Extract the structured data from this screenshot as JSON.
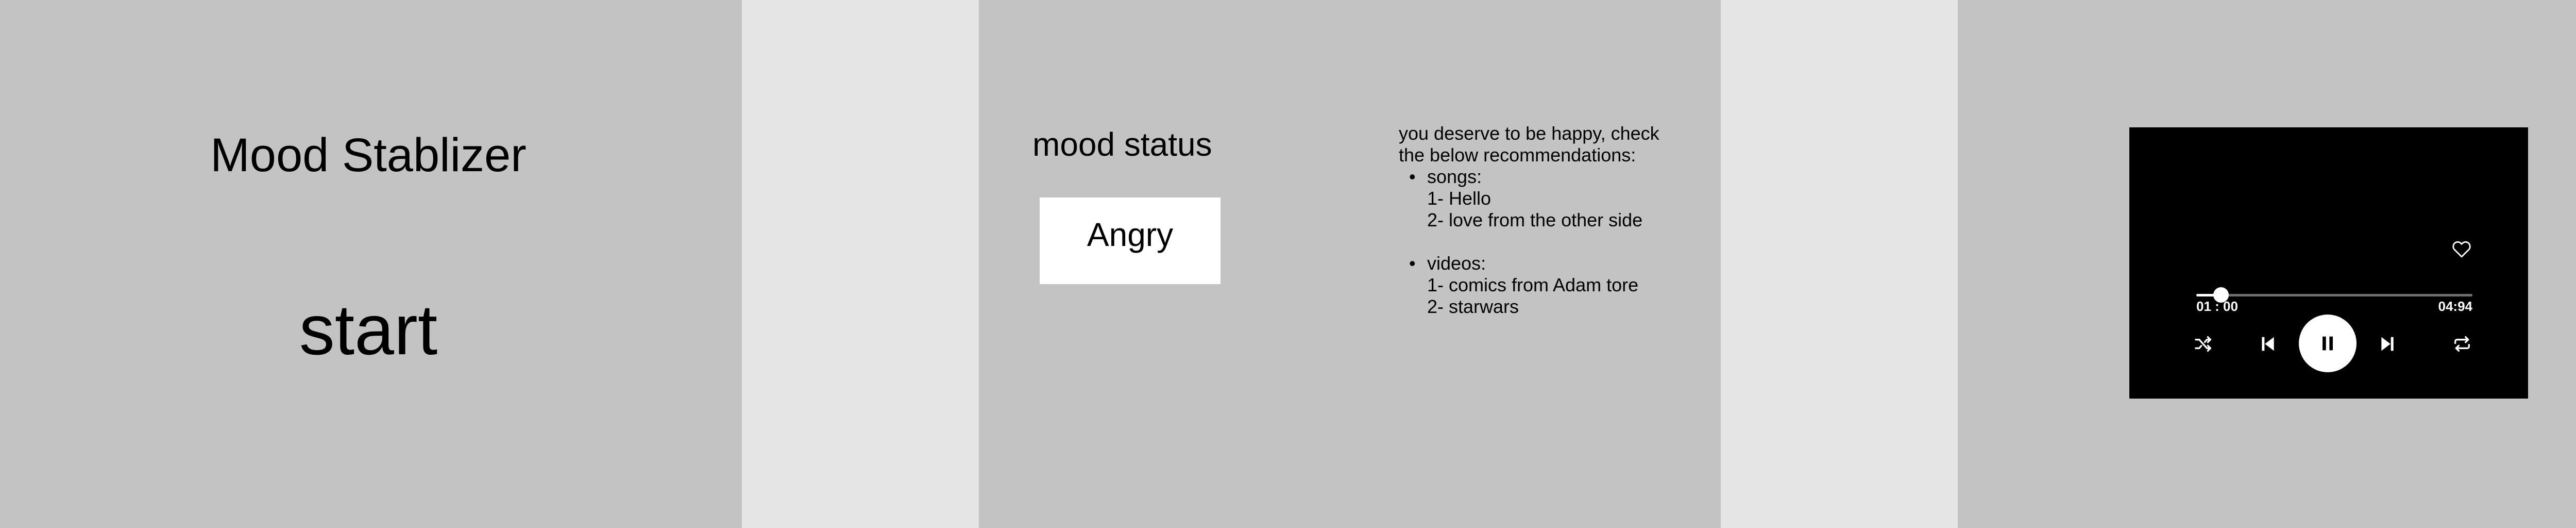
{
  "start_screen": {
    "title": "Mood Stablizer",
    "start_label": "start"
  },
  "mood_screen": {
    "heading": "mood status",
    "mood_value": "Angry",
    "recommendations": {
      "intro": "you deserve to be happy, check the below recommendations:",
      "categories": [
        {
          "label": "songs:",
          "items": [
            "1- Hello",
            "2- love from the other side"
          ]
        },
        {
          "label": "videos:",
          "items": [
            "1- comics from Adam tore",
            "2- starwars"
          ]
        }
      ],
      "bullet": "•"
    }
  },
  "player_screen": {
    "current_time": "01 : 00",
    "total_time": "04:94",
    "progress_fraction": 0.09,
    "icons": {
      "favorite": "heart-icon",
      "shuffle": "shuffle-icon",
      "previous": "skip-previous-icon",
      "play_pause": "pause-icon",
      "next": "skip-next-icon",
      "repeat": "repeat-icon"
    }
  },
  "colors": {
    "screen_background": "#c3c3c3",
    "page_background": "#e5e5e5",
    "mood_box": "#ffffff",
    "player_background": "#000000",
    "player_foreground": "#ffffff"
  }
}
